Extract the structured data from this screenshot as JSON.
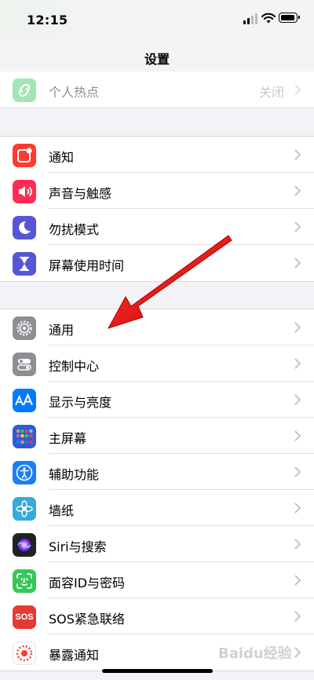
{
  "status": {
    "time": "12:15"
  },
  "nav": {
    "title": "设置"
  },
  "group0": [
    {
      "label": "个人热点",
      "value": "关闭",
      "icon": "hotspot-icon",
      "color": "#34c759"
    }
  ],
  "group1": [
    {
      "label": "通知",
      "icon": "notifications-icon",
      "color": "#ff3b30"
    },
    {
      "label": "声音与触感",
      "icon": "speaker-icon",
      "color": "#ff2d55"
    },
    {
      "label": "勿扰模式",
      "icon": "moon-icon",
      "color": "#5856d6"
    },
    {
      "label": "屏幕使用时间",
      "icon": "hourglass-icon",
      "color": "#5856d6"
    }
  ],
  "group2": [
    {
      "label": "通用",
      "icon": "gear-icon",
      "color": "#8e8e93"
    },
    {
      "label": "控制中心",
      "icon": "toggles-icon",
      "color": "#8e8e93"
    },
    {
      "label": "显示与亮度",
      "icon": "aa-icon",
      "color": "#007aff"
    },
    {
      "label": "主屏幕",
      "icon": "home-grid-icon",
      "color": "#2f5bd8"
    },
    {
      "label": "辅助功能",
      "icon": "accessibility-icon",
      "color": "#1a7ef5"
    },
    {
      "label": "墙纸",
      "icon": "flower-icon",
      "color": "#35aadc"
    },
    {
      "label": "Siri与搜索",
      "icon": "siri-icon",
      "color": "#222222"
    },
    {
      "label": "面容ID与密码",
      "icon": "face-id-icon",
      "color": "#34c759"
    },
    {
      "label": "SOS紧急联络",
      "icon": "sos-icon",
      "color": "#e53935"
    },
    {
      "label": "暴露通知",
      "icon": "exposure-icon",
      "color": "#ffffff"
    }
  ],
  "watermark": "Baidu经验"
}
